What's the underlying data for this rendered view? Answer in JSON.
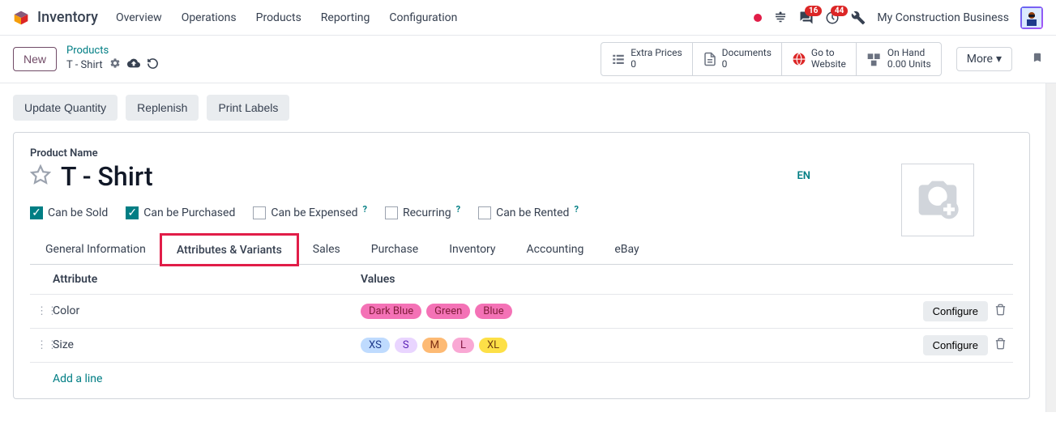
{
  "nav": {
    "app": "Inventory",
    "items": [
      "Overview",
      "Operations",
      "Products",
      "Reporting",
      "Configuration"
    ],
    "msg_badge": "16",
    "act_badge": "44",
    "company": "My Construction Business"
  },
  "subbar": {
    "new": "New",
    "breadcrumb_top": "Products",
    "breadcrumb_cur": "T - Shirt",
    "stats": [
      {
        "label": "Extra Prices",
        "value": "0"
      },
      {
        "label": "Documents",
        "value": "0"
      },
      {
        "label": "Go to",
        "value": "Website"
      },
      {
        "label": "On Hand",
        "value": "0.00 Units"
      }
    ],
    "more": "More"
  },
  "actions": {
    "update": "Update Quantity",
    "replenish": "Replenish",
    "print": "Print Labels"
  },
  "product": {
    "label": "Product Name",
    "name": "T - Shirt",
    "lang": "EN",
    "checks": {
      "sold": "Can be Sold",
      "purchased": "Can be Purchased",
      "expensed": "Can be Expensed",
      "recurring": "Recurring",
      "rented": "Can be Rented"
    }
  },
  "tabs": [
    "General Information",
    "Attributes & Variants",
    "Sales",
    "Purchase",
    "Inventory",
    "Accounting",
    "eBay"
  ],
  "grid": {
    "head_attr": "Attribute",
    "head_val": "Values",
    "rows": [
      {
        "attr": "Color",
        "tags": [
          {
            "t": "Dark Blue",
            "bg": "#f472b6",
            "fg": "#7f1d3a"
          },
          {
            "t": "Green",
            "bg": "#f472b6",
            "fg": "#7f1d3a"
          },
          {
            "t": "Blue",
            "bg": "#f472b6",
            "fg": "#7f1d3a"
          }
        ]
      },
      {
        "attr": "Size",
        "tags": [
          {
            "t": "XS",
            "bg": "#bfdbfe",
            "fg": "#1e3a8a"
          },
          {
            "t": "S",
            "bg": "#e9d5ff",
            "fg": "#5b21b6"
          },
          {
            "t": "M",
            "bg": "#fdba74",
            "fg": "#7c2d12"
          },
          {
            "t": "L",
            "bg": "#f9a8d4",
            "fg": "#831843"
          },
          {
            "t": "XL",
            "bg": "#fde047",
            "fg": "#713f12"
          }
        ]
      }
    ],
    "configure": "Configure",
    "addline": "Add a line"
  }
}
